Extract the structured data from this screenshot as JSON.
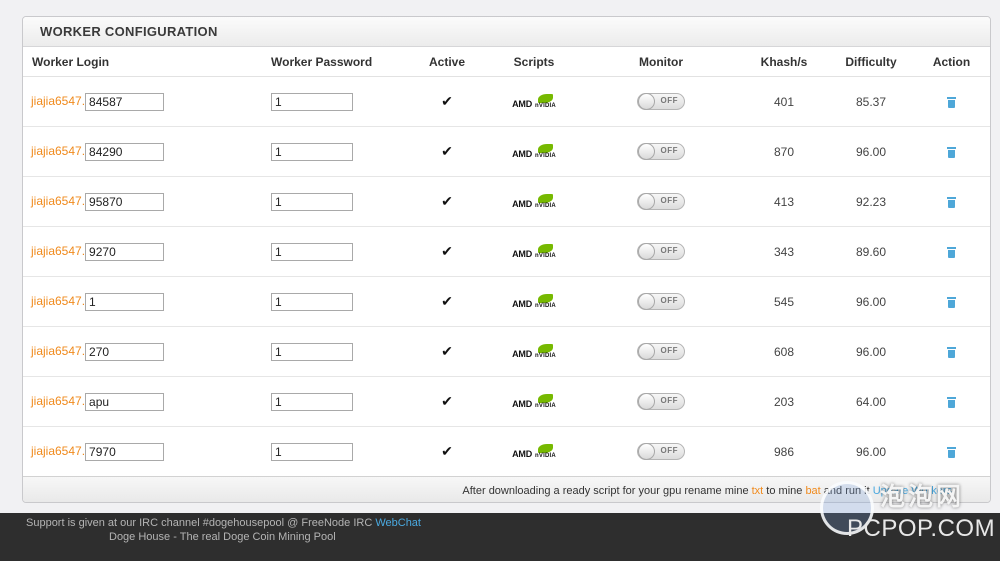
{
  "panel": {
    "title": "WORKER CONFIGURATION"
  },
  "columns": {
    "login": "Worker Login",
    "password": "Worker Password",
    "active": "Active",
    "scripts": "Scripts",
    "monitor": "Monitor",
    "khash": "Khash/s",
    "difficulty": "Difficulty",
    "action": "Action"
  },
  "login_prefix": "jiajia6547.",
  "workers": [
    {
      "name": "84587",
      "password": "1",
      "active": "✔",
      "monitor": "OFF",
      "khash": "401",
      "difficulty": "85.37"
    },
    {
      "name": "84290",
      "password": "1",
      "active": "✔",
      "monitor": "OFF",
      "khash": "870",
      "difficulty": "96.00"
    },
    {
      "name": "95870",
      "password": "1",
      "active": "✔",
      "monitor": "OFF",
      "khash": "413",
      "difficulty": "92.23"
    },
    {
      "name": "9270",
      "password": "1",
      "active": "✔",
      "monitor": "OFF",
      "khash": "343",
      "difficulty": "89.60"
    },
    {
      "name": "1",
      "password": "1",
      "active": "✔",
      "monitor": "OFF",
      "khash": "545",
      "difficulty": "96.00"
    },
    {
      "name": "270",
      "password": "1",
      "active": "✔",
      "monitor": "OFF",
      "khash": "608",
      "difficulty": "96.00"
    },
    {
      "name": "apu",
      "password": "1",
      "active": "✔",
      "monitor": "OFF",
      "khash": "203",
      "difficulty": "64.00"
    },
    {
      "name": "7970",
      "password": "1",
      "active": "✔",
      "monitor": "OFF",
      "khash": "986",
      "difficulty": "96.00"
    }
  ],
  "script_logos": {
    "amd": "AMD",
    "nvidia": "nVIDIA"
  },
  "footer_note": {
    "before": "After downloading a ready script for your gpu rename mine ",
    "ext1": "txt",
    "mid": " to mine ",
    "ext2": "bat",
    "after": " and run it ",
    "button": "Update Workers"
  },
  "bottom": {
    "support_text": "Support is given at our IRC channel #dogehousepool @ FreeNode IRC ",
    "webchat": "WebChat",
    "tagline": "Doge House - The real Doge Coin Mining Pool"
  },
  "watermark": {
    "cn": "泡泡网",
    "en": "PCPOP.COM"
  },
  "colors": {
    "accent_orange": "#f08a1c",
    "link_blue": "#4aa9e0",
    "nvidia_green": "#76b900",
    "trash_blue": "#4ea7d8"
  },
  "icons": {
    "delete": "trash-icon",
    "active": "checkmark-icon"
  }
}
